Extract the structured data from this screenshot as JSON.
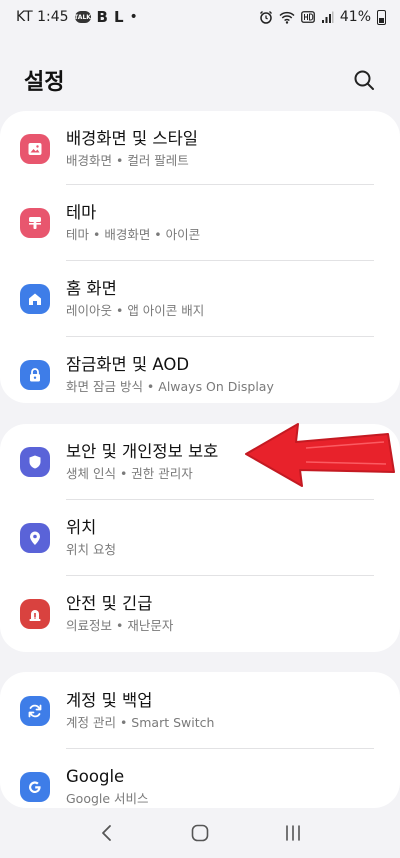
{
  "status_bar": {
    "carrier_time": "KT 1:45",
    "talk_badge": "TALK",
    "b_letter": "B",
    "l_letter": "L",
    "dot": "•",
    "battery": "41%"
  },
  "header": {
    "title": "설정"
  },
  "groups": [
    {
      "items": [
        {
          "title": "배경화면 및 스타일",
          "subtitle": "배경화면 • 컬러 팔레트",
          "icon": "palette-icon",
          "color": "#e8566e"
        },
        {
          "title": "테마",
          "subtitle": "테마 • 배경화면 • 아이콘",
          "icon": "brush-icon",
          "color": "#e8566e"
        },
        {
          "title": "홈 화면",
          "subtitle": "레이아웃 • 앱 아이콘 배지",
          "icon": "home-icon",
          "color": "#3e7de8"
        },
        {
          "title": "잠금화면 및 AOD",
          "subtitle": "화면 잠금 방식 • Always On Display",
          "icon": "lock-icon",
          "color": "#3e7de8"
        }
      ]
    },
    {
      "items": [
        {
          "title": "보안 및 개인정보 보호",
          "subtitle": "생체 인식 • 권한 관리자",
          "icon": "shield-icon",
          "color": "#5a63d8"
        },
        {
          "title": "위치",
          "subtitle": "위치 요청",
          "icon": "location-pin-icon",
          "color": "#5a63d8"
        },
        {
          "title": "안전 및 긴급",
          "subtitle": "의료정보 • 재난문자",
          "icon": "emergency-icon",
          "color": "#d9423f"
        }
      ]
    },
    {
      "items": [
        {
          "title": "계정 및 백업",
          "subtitle": "계정 관리 • Smart Switch",
          "icon": "sync-icon",
          "color": "#3e7de8"
        },
        {
          "title": "Google",
          "subtitle": "Google 서비스",
          "icon": "google-icon",
          "color": "#3e7de8"
        }
      ]
    }
  ],
  "colors": {
    "background": "#f3f3f6",
    "card": "#ffffff",
    "annotation_arrow": "#e8222b"
  }
}
